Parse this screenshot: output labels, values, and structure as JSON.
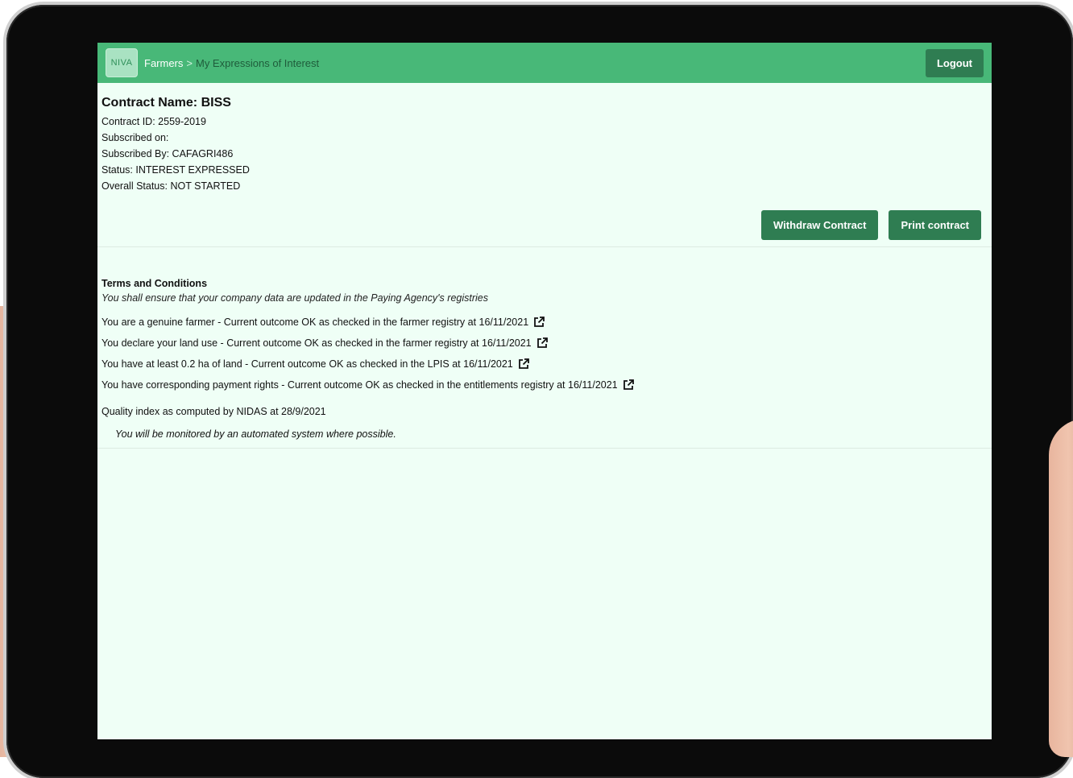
{
  "nav": {
    "logo_text": "NIVA",
    "breadcrumb_root": "Farmers",
    "breadcrumb_sep": ">",
    "breadcrumb_current": "My Expressions of Interest",
    "logout_label": "Logout"
  },
  "contract": {
    "title": "Contract Name: BISS",
    "lines": [
      "Contract ID: 2559-2019",
      "Subscribed on:",
      "Subscribed By: CAFAGRI486",
      "Status: INTEREST EXPRESSED",
      "Overall Status: NOT STARTED"
    ],
    "withdraw_label": "Withdraw Contract",
    "print_label": "Print contract"
  },
  "terms": {
    "heading": "Terms and Conditions",
    "subheading": "You shall ensure that your company data are updated in the Paying Agency's registries",
    "items": [
      "You are a genuine farmer - Current outcome OK as checked in the farmer registry at 16/11/2021",
      "You declare your land use - Current outcome OK as checked in the farmer registry at 16/11/2021",
      "You have at least 0.2 ha of land - Current outcome OK as checked in the LPIS at 16/11/2021",
      "You have corresponding payment rights - Current outcome OK as checked in the entitlements registry at 16/11/2021"
    ],
    "quality": "Quality index as computed by NIDAS at 28/9/2021",
    "monitor": "You will be monitored by an automated system where possible."
  },
  "icons": {
    "external_link": "external-link-icon"
  },
  "colors": {
    "navbar": "#48b878",
    "button": "#2f7d52",
    "background": "#effff6"
  }
}
